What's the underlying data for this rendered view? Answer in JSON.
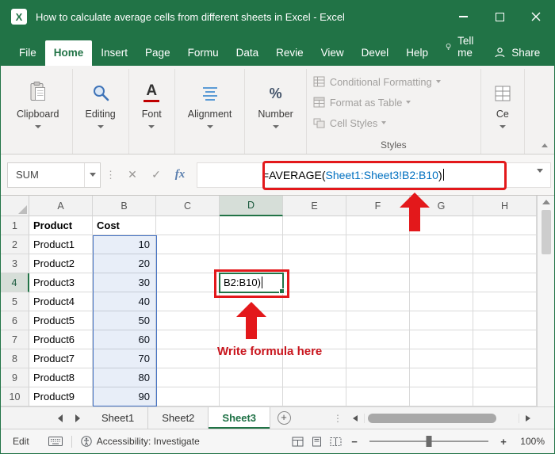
{
  "window": {
    "title": "How to calculate average cells from different sheets in Excel - Excel"
  },
  "menubar": {
    "tabs": [
      {
        "label": "File"
      },
      {
        "label": "Home",
        "active": true
      },
      {
        "label": "Insert"
      },
      {
        "label": "Page"
      },
      {
        "label": "Formu"
      },
      {
        "label": "Data"
      },
      {
        "label": "Revie"
      },
      {
        "label": "View"
      },
      {
        "label": "Devel"
      },
      {
        "label": "Help"
      }
    ],
    "tell_me": "Tell me",
    "share": "Share"
  },
  "ribbon": {
    "groups": [
      {
        "label": "Clipboard"
      },
      {
        "label": "Editing"
      },
      {
        "label": "Font"
      },
      {
        "label": "Alignment"
      },
      {
        "label": "Number"
      }
    ],
    "styles": {
      "items": [
        "Conditional Formatting",
        "Format as Table",
        "Cell Styles"
      ],
      "caption": "Styles"
    },
    "cells_partial": "Ce"
  },
  "formula_bar": {
    "name_box": "SUM",
    "formula": {
      "prefix": "=AVERAGE(",
      "reference": "Sheet1:Sheet3!B2:B10",
      "suffix": ")"
    }
  },
  "sheet": {
    "col_headers": [
      "A",
      "B",
      "C",
      "D",
      "E",
      "F",
      "G",
      "H"
    ],
    "rows": [
      {
        "n": "1",
        "product": "Product",
        "cost": "Cost"
      },
      {
        "n": "2",
        "product": "Product1",
        "cost": "10"
      },
      {
        "n": "3",
        "product": "Product2",
        "cost": "20"
      },
      {
        "n": "4",
        "product": "Product3",
        "cost": "30"
      },
      {
        "n": "5",
        "product": "Product4",
        "cost": "40"
      },
      {
        "n": "6",
        "product": "Product5",
        "cost": "50"
      },
      {
        "n": "7",
        "product": "Product6",
        "cost": "60"
      },
      {
        "n": "8",
        "product": "Product7",
        "cost": "70"
      },
      {
        "n": "9",
        "product": "Product8",
        "cost": "80"
      },
      {
        "n": "10",
        "product": "Product9",
        "cost": "90"
      }
    ],
    "edit_cell": {
      "ref": "D4",
      "value": "B2:B10)"
    }
  },
  "annotations": {
    "write_formula_label": "Write formula here"
  },
  "tabbar": {
    "sheets": [
      {
        "label": "Sheet1"
      },
      {
        "label": "Sheet2"
      },
      {
        "label": "Sheet3",
        "active": true
      }
    ]
  },
  "statusbar": {
    "mode": "Edit",
    "accessibility": "Accessibility: Investigate",
    "zoom": "100%"
  },
  "icons": {
    "excel_logo": "X",
    "cancel": "✕",
    "enter": "✓",
    "fx": "fx",
    "drag_dots": "⋮",
    "new_sheet": "+",
    "zoom_out": "−",
    "zoom_in": "+",
    "font_letter": "A",
    "percent": "%"
  },
  "colors": {
    "excel_green": "#217346",
    "annotation_red": "#e3181b",
    "label_red": "#c9151d",
    "reference_blue": "#0070c0",
    "selection_blue": "#4472c4"
  }
}
